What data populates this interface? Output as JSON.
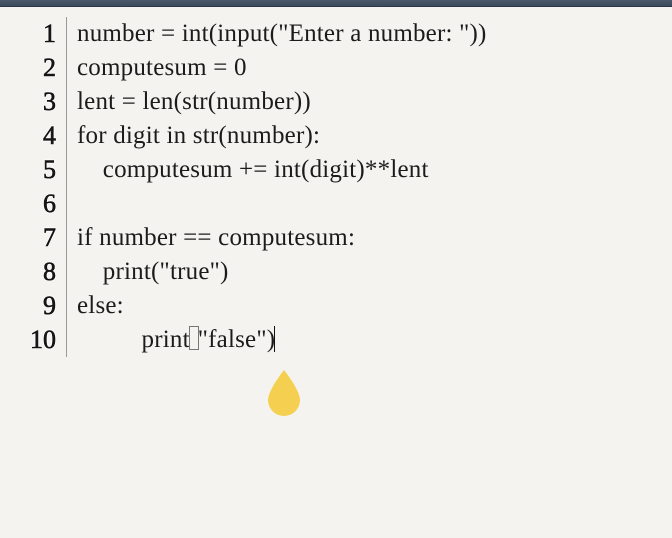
{
  "editor": {
    "lines": [
      {
        "n": "1",
        "text": "number = int(input(\"Enter a number: \"))"
      },
      {
        "n": "2",
        "text": "computesum = 0"
      },
      {
        "n": "3",
        "text": "lent = len(str(number))"
      },
      {
        "n": "4",
        "text": "for digit in str(number):"
      },
      {
        "n": "5",
        "text": "    computesum += int(digit)**lent"
      },
      {
        "n": "6",
        "text": ""
      },
      {
        "n": "7",
        "text": "if number == computesum:"
      },
      {
        "n": "8",
        "text": "    print(\"true\")"
      },
      {
        "n": "9",
        "text": "else:"
      },
      {
        "n": "10",
        "text": "    print(\"false\")"
      }
    ],
    "cursor_line": 10,
    "cursor_after": "print(\"false\")"
  },
  "marker": {
    "color": "#f5cf4f",
    "shape": "teardrop"
  }
}
